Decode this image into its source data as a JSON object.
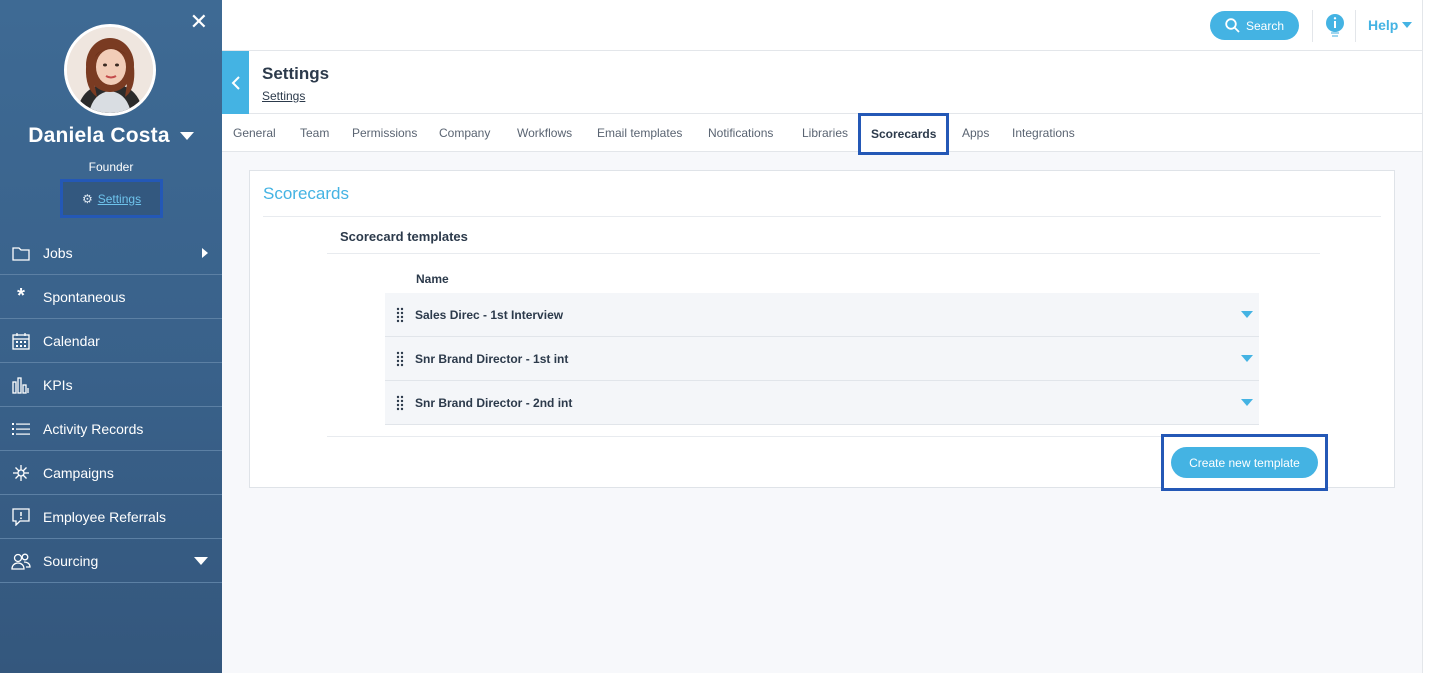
{
  "sidebar": {
    "user_name": "Daniela Costa",
    "role": "Founder",
    "settings_link": "Settings",
    "items": [
      {
        "label": "Jobs",
        "icon": "folder-icon"
      },
      {
        "label": "Spontaneous",
        "icon": "asterisk-icon"
      },
      {
        "label": "Calendar",
        "icon": "calendar-icon"
      },
      {
        "label": "KPIs",
        "icon": "bar-chart-icon"
      },
      {
        "label": "Activity Records",
        "icon": "list-icon"
      },
      {
        "label": "Campaigns",
        "icon": "sparkle-icon"
      },
      {
        "label": "Employee Referrals",
        "icon": "chat-icon"
      },
      {
        "label": "Sourcing",
        "icon": "people-icon"
      }
    ]
  },
  "topbar": {
    "search_label": "Search",
    "help_label": "Help"
  },
  "header": {
    "title": "Settings",
    "breadcrumb": "Settings"
  },
  "tabs": [
    "General",
    "Team",
    "Permissions",
    "Company",
    "Workflows",
    "Email templates",
    "Notifications",
    "Libraries",
    "Scorecards",
    "Apps",
    "Integrations"
  ],
  "active_tab": "Scorecards",
  "main": {
    "card_title": "Scorecards",
    "section_title": "Scorecard templates",
    "column_header": "Name",
    "templates": [
      "Sales Direc - 1st Interview",
      "Snr Brand Director - 1st int",
      "Snr Brand Director - 2nd int"
    ],
    "create_button": "Create new template"
  },
  "colors": {
    "accent": "#44b3e3",
    "sidebar": "#3b6590",
    "highlight": "#2458b6"
  }
}
